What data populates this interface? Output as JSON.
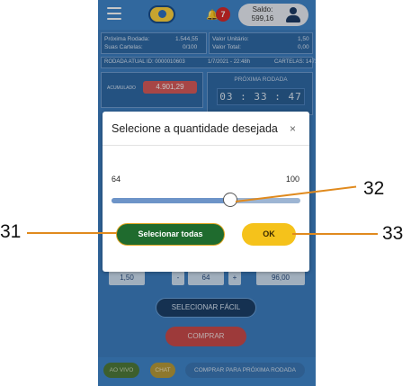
{
  "header": {
    "notification_count": "7",
    "saldo_label": "Saldo:",
    "saldo_value": "599,16"
  },
  "info": {
    "proxima_rodada_label": "Próxima Rodada:",
    "proxima_rodada_value": "1.544,55",
    "suas_cartelas_label": "Suas Cartelas:",
    "suas_cartelas_value": "0/100",
    "valor_unitario_label": "Valor Unitário:",
    "valor_unitario_value": "1,50",
    "valor_total_label": "Valor Total:",
    "valor_total_value": "0,00",
    "rodada_atual": "RODADA ATUAL ID: 0000010603",
    "rodada_date": "1/7/2021 - 22:48h",
    "cartelas": "CARTELAS: 1471",
    "acumulado_label": "ACUMULADO",
    "acumulado_value": "4.901,29",
    "proxima_rodada_title": "PRÓXIMA RODADA",
    "timer": "03 : 33 : 47"
  },
  "purchase": {
    "unit_price": "1,50",
    "minus": "-",
    "quantity": "64",
    "plus": "+",
    "total": "96,00",
    "selecionar_facil": "SELECIONAR FÁCIL",
    "comprar": "COMPRAR"
  },
  "footer": {
    "ao_vivo": "AO VIVO",
    "chat": "CHAT",
    "comprar_proxima": "COMPRAR PARA PRÓXIMA RODADA"
  },
  "modal": {
    "title": "Selecione a quantidade desejada",
    "close": "×",
    "range_min": "64",
    "range_max": "100",
    "slider_fraction": 0.63,
    "select_all_label": "Selecionar todas",
    "ok_label": "OK"
  },
  "annotations": {
    "slider": "32",
    "select_all": "31",
    "ok": "33"
  },
  "colors": {
    "callout": "#e08a1e",
    "select_all_bg": "#1f6b2e",
    "ok_bg": "#f5c21b",
    "app_bg": "#3d7ec0"
  }
}
